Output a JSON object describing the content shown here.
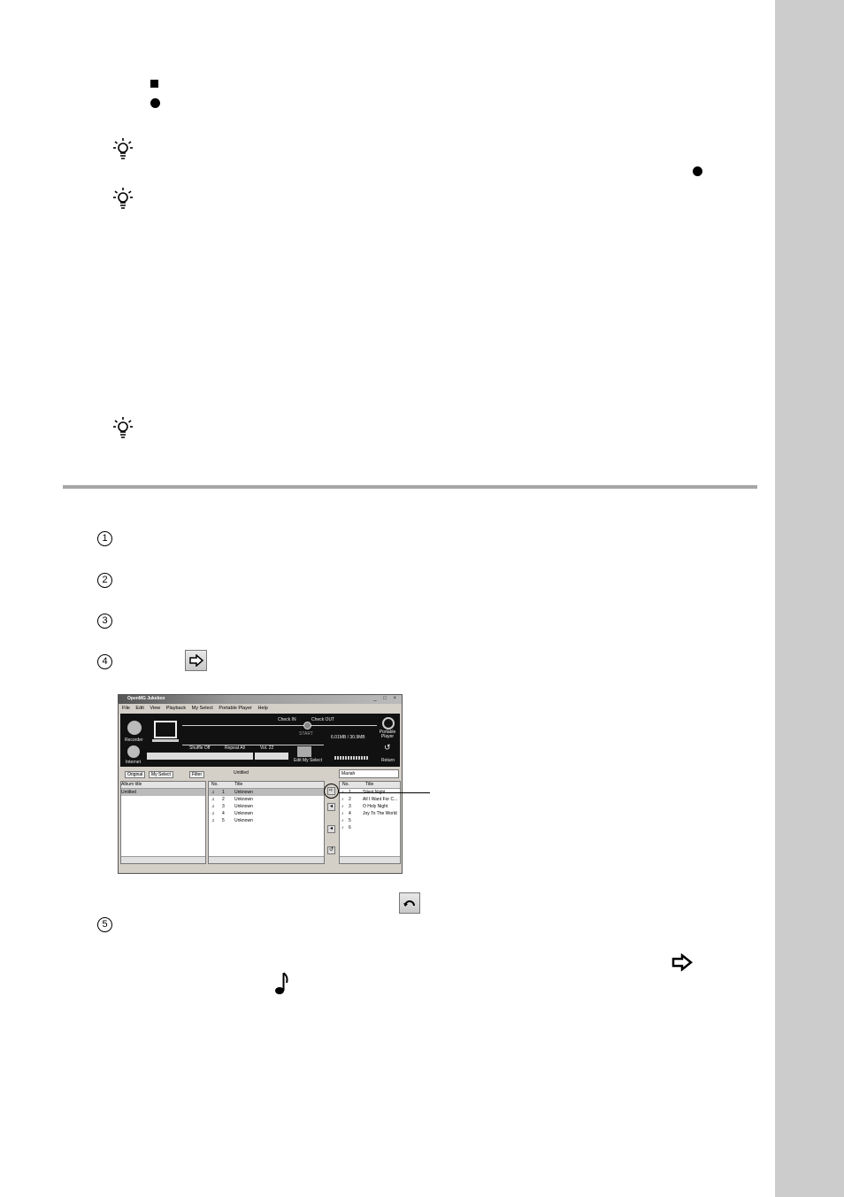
{
  "icons": {
    "stop": "black-square",
    "record": "black-circle",
    "hint": "light-bulb",
    "step": "circled-digit",
    "transfer": "right-arrow-button",
    "undo": "return-arrow-button",
    "track": "music-note"
  },
  "steps": [
    "1",
    "2",
    "3",
    "4",
    "5"
  ],
  "app": {
    "title": "OpenMG Jukebox",
    "window_controls": "_ □ ×",
    "menu": [
      "File",
      "Edit",
      "View",
      "Playback",
      "My Select",
      "Portable Player",
      "Help"
    ],
    "panel": {
      "recorder": "Recorder",
      "internet": "Internet",
      "check_in": "Check IN",
      "check_out": "Check OUT",
      "start": "START",
      "portable_player": "Portable Player",
      "capacity": "6.01MB / 30.9MB",
      "shuffle": "Shuffle Off",
      "repeat": "Repeat All",
      "volume": "Vol. 22",
      "edit_my_select": "Edit My Select",
      "return": "Return"
    },
    "tabs": {
      "original": "Original",
      "my_select": "My Select",
      "filter": "Filter"
    },
    "header_left": "Untitled",
    "header_right": "Mariah",
    "album_list": {
      "header": "Album title",
      "items": [
        "Untitled"
      ]
    },
    "track_list": {
      "headers": [
        "No.",
        "Title"
      ],
      "rows": [
        {
          "no": "1",
          "title": "Unknown"
        },
        {
          "no": "2",
          "title": "Unknown"
        },
        {
          "no": "3",
          "title": "Unknown"
        },
        {
          "no": "4",
          "title": "Unknown"
        },
        {
          "no": "5",
          "title": "Unknown"
        }
      ]
    },
    "device_list": {
      "headers": [
        "No.",
        "Title"
      ],
      "rows": [
        {
          "no": "1",
          "title": "Silent Night"
        },
        {
          "no": "2",
          "title": "All I Want For C..."
        },
        {
          "no": "3",
          "title": "O Holy Night"
        },
        {
          "no": "4",
          "title": "Joy To The World"
        },
        {
          "no": "5",
          "title": ""
        },
        {
          "no": "6",
          "title": ""
        }
      ]
    }
  }
}
